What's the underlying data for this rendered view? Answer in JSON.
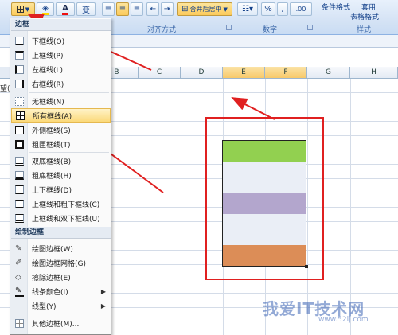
{
  "ribbon": {
    "merge_label": "合并后居中",
    "percent_label": "%",
    "comma_label": ",",
    "dec_label": ".00",
    "align_group": "对齐方式",
    "number_group": "数字",
    "style_group": "样式",
    "cond_format": "条件格式",
    "table_format": "表格格式",
    "apply_label": "套用"
  },
  "sheet": {
    "columns": [
      "B",
      "C",
      "D",
      "E",
      "F",
      "G",
      "H"
    ],
    "selected_col": "E",
    "fill_colors": [
      "#92d050",
      "#eaeef6",
      "#b3a6cd",
      "#eaeef6",
      "#dc8d57"
    ]
  },
  "menu": {
    "header_border": "边框",
    "items_top": [
      {
        "label": "下框线(O)",
        "hl": false
      },
      {
        "label": "上框线(P)",
        "hl": false
      },
      {
        "label": "左框线(L)",
        "hl": false
      },
      {
        "label": "右框线(R)",
        "hl": false
      },
      {
        "label": "无框线(N)",
        "hl": false
      },
      {
        "label": "所有框线(A)",
        "hl": true
      },
      {
        "label": "外侧框线(S)",
        "hl": false
      },
      {
        "label": "粗匣框线(T)",
        "hl": false
      },
      {
        "label": "双底框线(B)",
        "hl": false
      },
      {
        "label": "粗底框线(H)",
        "hl": false
      },
      {
        "label": "上下框线(D)",
        "hl": false
      },
      {
        "label": "上框线和粗下框线(C)",
        "hl": false
      },
      {
        "label": "上框线和双下框线(U)",
        "hl": false
      }
    ],
    "header_draw": "绘制边框",
    "items_draw": [
      {
        "label": "绘图边框(W)",
        "sub": false
      },
      {
        "label": "绘图边框网格(G)",
        "sub": false
      },
      {
        "label": "擦除边框(E)",
        "sub": false
      },
      {
        "label": "线条颜色(I)",
        "sub": true
      },
      {
        "label": "线型(Y)",
        "sub": true
      },
      {
        "label": "其他边框(M)...",
        "sub": false
      }
    ],
    "side_text": "望("
  },
  "watermark": {
    "text": "我爱IT技术网",
    "url": "www.52ij.com"
  }
}
